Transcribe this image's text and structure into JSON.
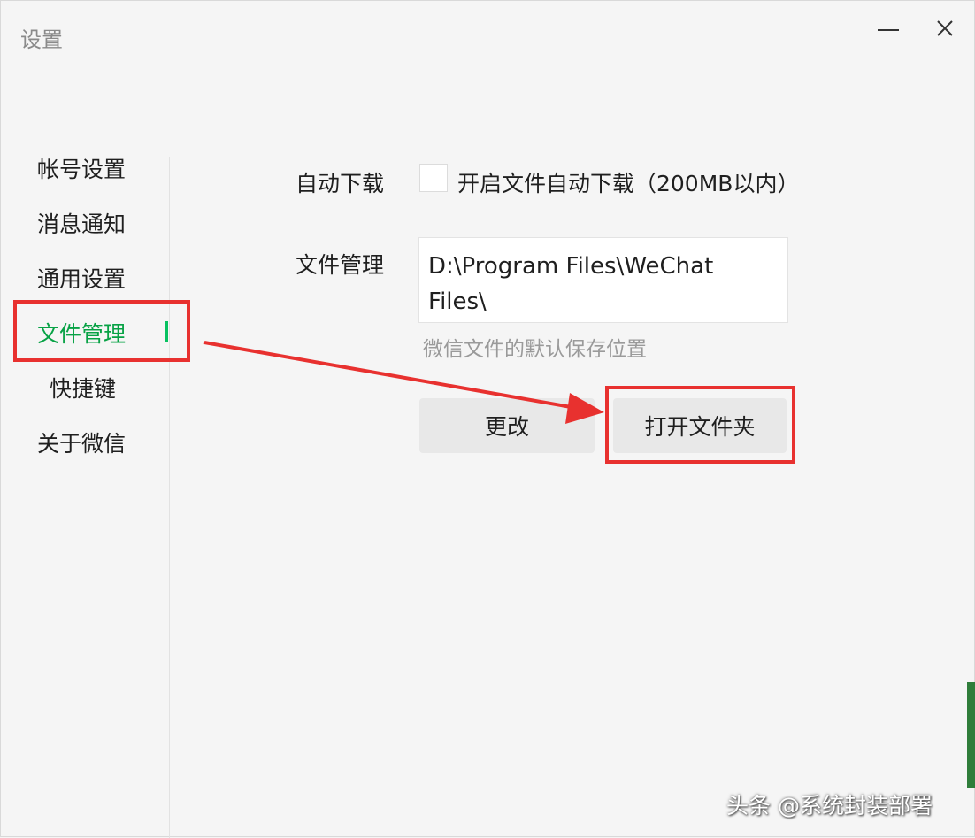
{
  "window": {
    "title": "设置"
  },
  "sidebar": {
    "items": [
      {
        "label": "帐号设置"
      },
      {
        "label": "消息通知"
      },
      {
        "label": "通用设置"
      },
      {
        "label": "文件管理"
      },
      {
        "label": "快捷键"
      },
      {
        "label": "关于微信"
      }
    ],
    "active_index": 3
  },
  "auto_download": {
    "label": "自动下载",
    "checkbox_label": "开启文件自动下载（200MB以内）",
    "checked": false
  },
  "file_management": {
    "label": "文件管理",
    "path": "D:\\Program Files\\WeChat Files\\",
    "hint": "微信文件的默认保存位置",
    "change_label": "更改",
    "open_folder_label": "打开文件夹"
  },
  "watermark": "头条 @系统封装部署",
  "colors": {
    "accent": "#07c160",
    "annotation": "#e8312f"
  }
}
